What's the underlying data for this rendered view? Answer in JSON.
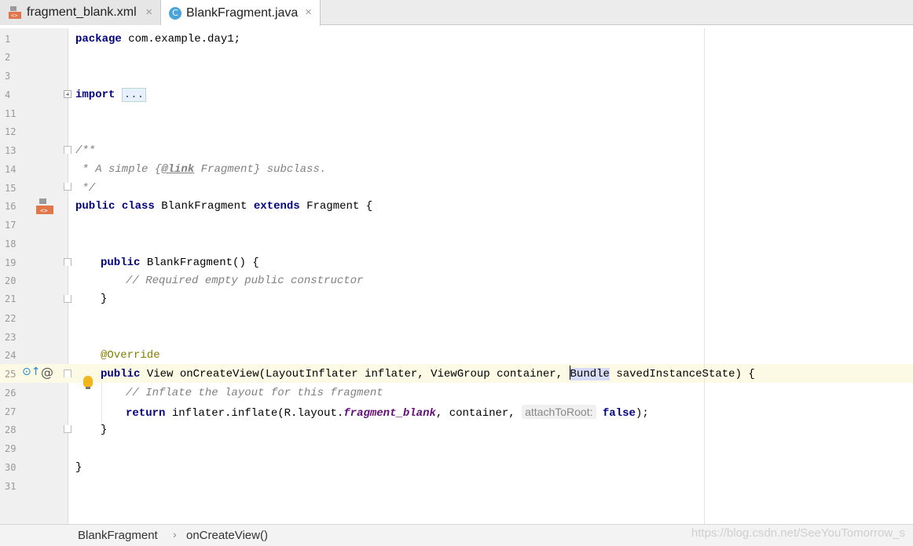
{
  "tabs": [
    {
      "label": "fragment_blank.xml",
      "icon": "xml-layout-icon",
      "active": false
    },
    {
      "label": "BlankFragment.java",
      "icon": "class-c-icon",
      "active": true
    }
  ],
  "class_icon_letter": "C",
  "close_glyph": "×",
  "line_numbers": [
    "1",
    "2",
    "3",
    "4",
    "11",
    "12",
    "13",
    "14",
    "15",
    "16",
    "17",
    "18",
    "19",
    "20",
    "21",
    "22",
    "23",
    "24",
    "25",
    "26",
    "27",
    "28",
    "29",
    "30",
    "31"
  ],
  "code": {
    "l1_kw": "package",
    "l1_rest": " com.example.day1;",
    "l4_kw": "import",
    "l4_fold": "...",
    "l13": "/**",
    "l14_a": " * A simple {",
    "l14_tag": "@link",
    "l14_b": " Fragment} subclass.",
    "l15": " */",
    "l16_kw1": "public",
    "l16_kw2": "class",
    "l16_name": " BlankFragment ",
    "l16_kw3": "extends",
    "l16_rest": " Fragment {",
    "l19_kw": "public",
    "l19_rest": " BlankFragment() {",
    "l20": "// Required empty public constructor",
    "l21": "}",
    "l24": "@Override",
    "l25_kw": "public",
    "l25_a": " View onCreateView(LayoutInflater inflater, ViewGroup container, ",
    "l25_sel": "Bundle",
    "l25_b": " savedInstanceState) {",
    "l26": "// Inflate the layout for this fragment",
    "l27_kw": "return",
    "l27_a": " inflater.inflate(R.layout.",
    "l27_fld": "fragment_blank",
    "l27_b": ", container, ",
    "l27_hint": "attachToRoot:",
    "l27_false": "false",
    "l27_end": ");",
    "l28": "}",
    "l30": "}"
  },
  "breadcrumb": {
    "class": "BlankFragment",
    "method": "onCreateView()",
    "separator": "›"
  },
  "watermark": "https://blog.csdn.net/SeeYouTomorrow_s",
  "gutter_icons": {
    "override": "⊙↑",
    "implements": "@"
  },
  "colors": {
    "keyword": "#000080",
    "comment": "#808080",
    "annotation": "#808000",
    "field": "#660e7a",
    "caret_row": "#fcf9e4"
  }
}
